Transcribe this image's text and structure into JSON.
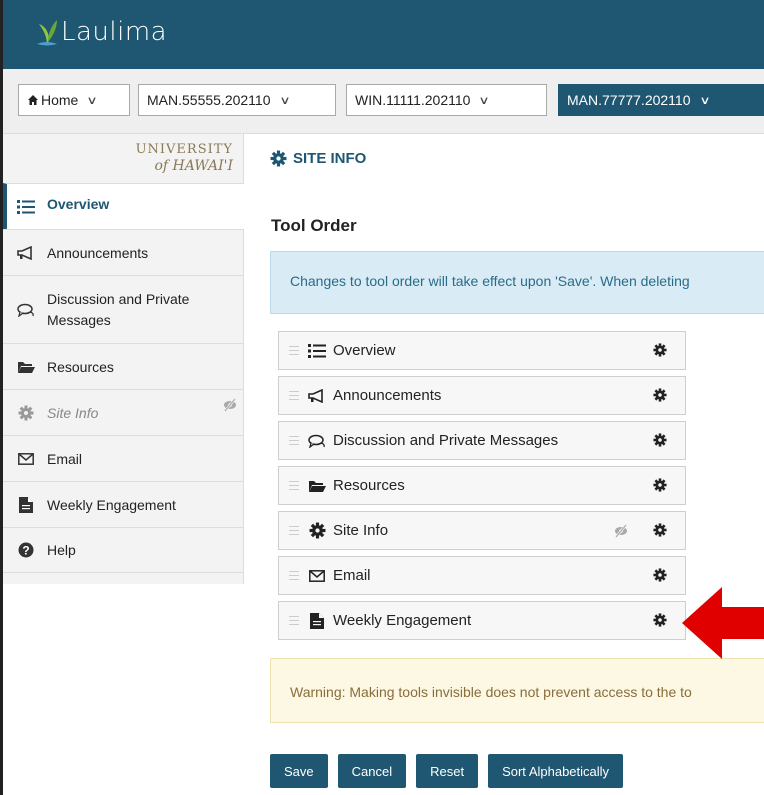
{
  "app": {
    "title": "Laulima"
  },
  "sitebar": {
    "home": "Home",
    "sites": [
      "MAN.55555.202110",
      "WIN.11111.202110",
      "MAN.77777.202110"
    ]
  },
  "sidebar": {
    "logo": {
      "line1": "UNIVERSITY",
      "line2": "of HAWAI'I"
    },
    "items": [
      {
        "label": "Overview",
        "icon": "list-icon"
      },
      {
        "label": "Announcements",
        "icon": "megaphone-icon"
      },
      {
        "label": "Discussion and Private Messages",
        "icon": "chat-icon"
      },
      {
        "label": "Resources",
        "icon": "folder-icon"
      },
      {
        "label": "Site Info",
        "icon": "gear-icon"
      },
      {
        "label": "Email",
        "icon": "envelope-icon"
      },
      {
        "label": "Weekly Engagement",
        "icon": "document-icon"
      },
      {
        "label": "Help",
        "icon": "question-icon"
      }
    ]
  },
  "main": {
    "section_title": "SITE INFO",
    "heading": "Tool Order",
    "info": "Changes to tool order will take effect upon 'Save'. When deleting",
    "tools": [
      {
        "label": "Overview",
        "icon": "list-icon"
      },
      {
        "label": "Announcements",
        "icon": "megaphone-icon"
      },
      {
        "label": "Discussion and Private Messages",
        "icon": "chat-icon"
      },
      {
        "label": "Resources",
        "icon": "folder-icon"
      },
      {
        "label": "Site Info",
        "icon": "gear-icon"
      },
      {
        "label": "Email",
        "icon": "envelope-icon"
      },
      {
        "label": "Weekly Engagement",
        "icon": "document-icon"
      }
    ],
    "warning": "Warning: Making tools invisible does not prevent access to the to",
    "buttons": {
      "save": "Save",
      "cancel": "Cancel",
      "reset": "Reset",
      "sort": "Sort Alphabetically"
    }
  },
  "colors": {
    "brand": "#1f5671",
    "arrow": "#e00000"
  }
}
